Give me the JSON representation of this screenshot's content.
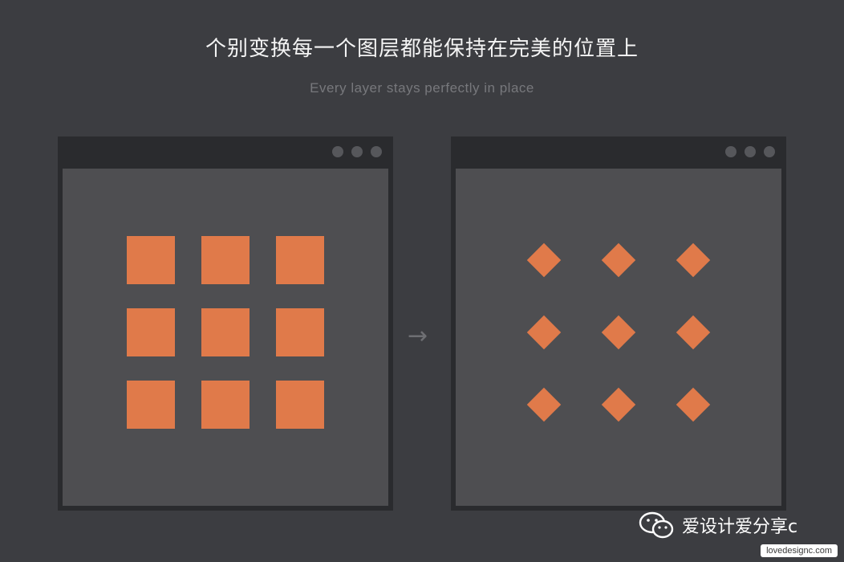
{
  "header": {
    "title": "个别变换每一个图层都能保持在完美的位置上",
    "subtitle": "Every layer stays perfectly in place"
  },
  "colors": {
    "background": "#3c3d41",
    "window_frame": "#2a2b2e",
    "canvas": "#4e4e51",
    "shape_orange": "#e07a4a",
    "dot": "#56575b"
  },
  "left_window": {
    "shape": "square",
    "grid": [
      [
        1,
        1,
        1
      ],
      [
        1,
        1,
        1
      ],
      [
        1,
        1,
        1
      ]
    ]
  },
  "right_window": {
    "shape": "diamond",
    "grid": [
      [
        1,
        1,
        1
      ],
      [
        1,
        1,
        1
      ],
      [
        1,
        1,
        1
      ]
    ]
  },
  "arrow_icon": "right-arrow-icon",
  "watermark": {
    "icon": "wechat-icon",
    "text": "爱设计爱分享c",
    "url": "lovedesignc.com"
  }
}
